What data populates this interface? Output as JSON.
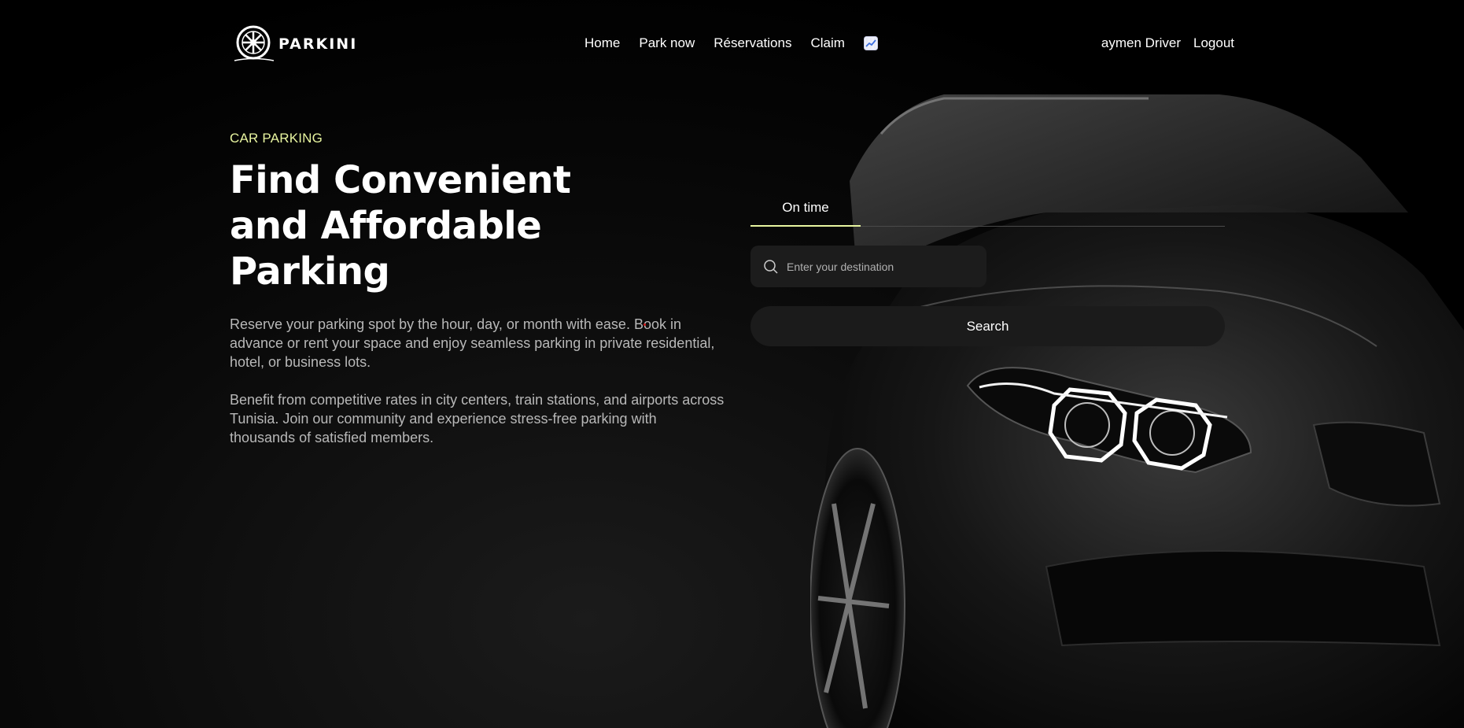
{
  "brand": {
    "name": "PARKINI",
    "logo_icon": "wheel-logo-icon"
  },
  "nav": {
    "items": [
      {
        "label": "Home"
      },
      {
        "label": "Park now"
      },
      {
        "label": "Réservations"
      },
      {
        "label": "Claim"
      }
    ],
    "stats_icon": "chart-increasing-icon"
  },
  "user": {
    "name": "aymen Driver",
    "logout_label": "Logout"
  },
  "hero": {
    "eyebrow": "CAR PARKING",
    "headline": "Find Convenient and Affordable Parking",
    "paragraph_1": "Reserve your parking spot by the hour, day, or month with ease. Book in advance or rent your space and enjoy seamless parking in private residential, hotel, or business lots.",
    "paragraph_2": "Benefit from competitive rates in city centers, train stations, and airports across Tunisia. Join our community and experience stress-free parking with thousands of satisfied members."
  },
  "booking": {
    "active_tab": "On time",
    "search_placeholder": "Enter your destination",
    "search_value": "",
    "search_icon": "search-icon",
    "search_button_label": "Search"
  },
  "colors": {
    "accent": "#e8f5a0",
    "background": "#000000",
    "field_bg": "#1c1c1c",
    "muted_text": "#b8b8b8"
  }
}
